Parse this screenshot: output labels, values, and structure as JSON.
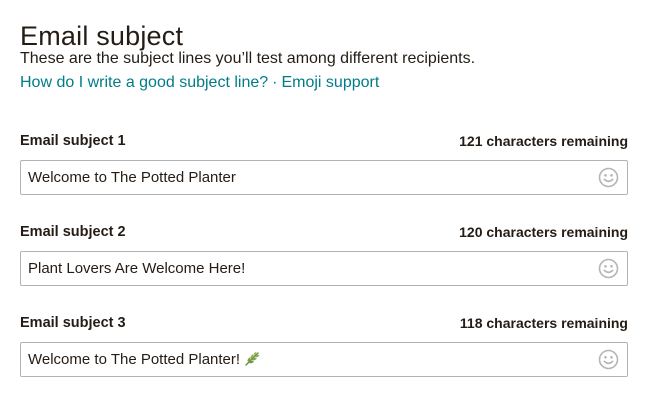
{
  "page": {
    "title": "Email subject",
    "description": "These are the subject lines you’ll test among different recipients.",
    "help_links": {
      "subject_help": "How do I write a good subject line?",
      "separator": "·",
      "emoji_support": "Emoji support"
    }
  },
  "subjects": [
    {
      "label": "Email subject 1",
      "remaining": "121 characters remaining",
      "value": "Welcome to The Potted Planter",
      "has_plant_emoji": false
    },
    {
      "label": "Email subject 2",
      "remaining": "120 characters remaining",
      "value": "Plant Lovers Are Welcome Here!",
      "has_plant_emoji": false
    },
    {
      "label": "Email subject 3",
      "remaining": "118 characters remaining",
      "value": "Welcome to The Potted Planter!",
      "has_plant_emoji": true
    }
  ],
  "icons": {
    "emoji_picker": "smiley-face-icon",
    "plant_emoji": "herb-icon"
  },
  "colors": {
    "text": "#241c15",
    "link": "#007c89",
    "input_border": "#b3b3b3",
    "icon_gray": "#b5b5b5"
  }
}
